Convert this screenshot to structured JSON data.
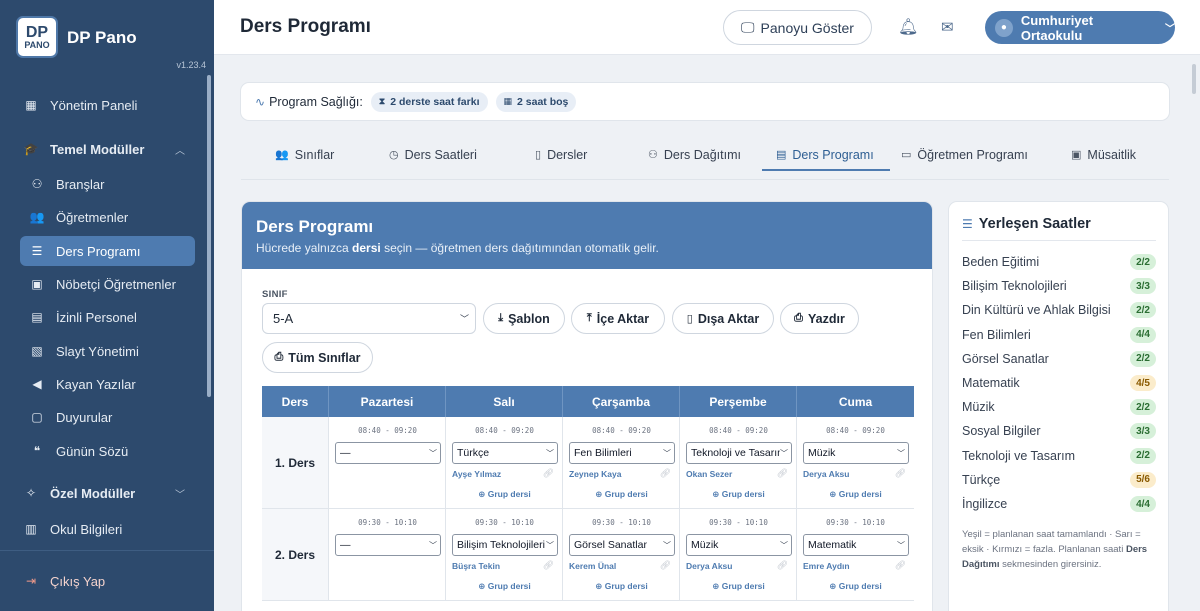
{
  "sidebar": {
    "brand": "DP Pano",
    "logo_top": "DP",
    "logo_bottom": "PANO",
    "version": "v1.23.4",
    "items": [
      {
        "label": "Yönetim Paneli",
        "icon": "dashboard-icon"
      },
      {
        "label": "Temel Modüller",
        "icon": "graduation-cap-icon"
      },
      {
        "label": "Branşlar",
        "icon": "sitemap-icon"
      },
      {
        "label": "Öğretmenler",
        "icon": "users-icon"
      },
      {
        "label": "Ders Programı",
        "icon": "list-icon"
      },
      {
        "label": "Nöbetçi Öğretmenler",
        "icon": "id-badge-icon"
      },
      {
        "label": "İzinli Personel",
        "icon": "calendar-icon"
      },
      {
        "label": "Slayt Yönetimi",
        "icon": "images-icon"
      },
      {
        "label": "Kayan Yazılar",
        "icon": "megaphone-icon"
      },
      {
        "label": "Duyurular",
        "icon": "bell-icon"
      },
      {
        "label": "Günün Sözü",
        "icon": "quote-icon"
      },
      {
        "label": "Özel Modüller",
        "icon": "puzzle-icon"
      },
      {
        "label": "Okul Bilgileri",
        "icon": "building-icon"
      }
    ],
    "logout": "Çıkış Yap"
  },
  "header": {
    "title": "Ders Programı",
    "show_board": "Panoyu Göster",
    "school": "Cumhuriyet Ortaokulu"
  },
  "health": {
    "label": "Program Sağlığı:",
    "pills": [
      "2 derste saat farkı",
      "2 saat boş"
    ]
  },
  "tabs": [
    {
      "label": "Sınıflar",
      "icon": "users-icon"
    },
    {
      "label": "Ders Saatleri",
      "icon": "clock-icon"
    },
    {
      "label": "Dersler",
      "icon": "book-icon"
    },
    {
      "label": "Ders Dağıtımı",
      "icon": "sitemap-icon"
    },
    {
      "label": "Ders Programı",
      "icon": "calendar-icon"
    },
    {
      "label": "Öğretmen Programı",
      "icon": "id-card-icon"
    },
    {
      "label": "Müsaitlik",
      "icon": "calendar-check-icon"
    }
  ],
  "active_tab": "Ders Programı",
  "card": {
    "title": "Ders Programı",
    "sub_pre": "Hücrede yalnızca ",
    "sub_bold": "dersi",
    "sub_post": " seçin — öğretmen ders dağıtımından otomatik gelir.",
    "class_label": "SINIF",
    "class_value": "5-A",
    "buttons": [
      "Şablon",
      "İçe Aktar",
      "Dışa Aktar",
      "Yazdır",
      "Tüm Sınıflar"
    ]
  },
  "table": {
    "headers": [
      "Ders",
      "Pazartesi",
      "Salı",
      "Çarşamba",
      "Perşembe",
      "Cuma"
    ],
    "group_label": "Grup dersi",
    "rows": [
      {
        "label": "1. Ders",
        "time": "08:40 - 09:20",
        "cells": [
          {
            "subject": "—",
            "teacher": ""
          },
          {
            "subject": "Türkçe",
            "teacher": "Ayşe Yılmaz"
          },
          {
            "subject": "Fen Bilimleri",
            "teacher": "Zeynep Kaya"
          },
          {
            "subject": "Teknoloji ve Tasarım",
            "teacher": "Okan Sezer"
          },
          {
            "subject": "Müzik",
            "teacher": "Derya Aksu"
          }
        ]
      },
      {
        "label": "2. Ders",
        "time": "09:30 - 10:10",
        "cells": [
          {
            "subject": "—",
            "teacher": ""
          },
          {
            "subject": "Bilişim Teknolojileri",
            "teacher": "Büşra Tekin"
          },
          {
            "subject": "Görsel Sanatlar",
            "teacher": "Kerem Ünal"
          },
          {
            "subject": "Müzik",
            "teacher": "Derya Aksu"
          },
          {
            "subject": "Matematik",
            "teacher": "Emre Aydın"
          }
        ]
      }
    ]
  },
  "placed": {
    "title": "Yerleşen Saatler",
    "items": [
      {
        "name": "Beden Eğitimi",
        "count": "2/2",
        "status": "ok"
      },
      {
        "name": "Bilişim Teknolojileri",
        "count": "3/3",
        "status": "ok"
      },
      {
        "name": "Din Kültürü ve Ahlak Bilgisi",
        "count": "2/2",
        "status": "ok"
      },
      {
        "name": "Fen Bilimleri",
        "count": "4/4",
        "status": "ok"
      },
      {
        "name": "Görsel Sanatlar",
        "count": "2/2",
        "status": "ok"
      },
      {
        "name": "Matematik",
        "count": "4/5",
        "status": "lack"
      },
      {
        "name": "Müzik",
        "count": "2/2",
        "status": "ok"
      },
      {
        "name": "Sosyal Bilgiler",
        "count": "3/3",
        "status": "ok"
      },
      {
        "name": "Teknoloji ve Tasarım",
        "count": "2/2",
        "status": "ok"
      },
      {
        "name": "Türkçe",
        "count": "5/6",
        "status": "lack"
      },
      {
        "name": "İngilizce",
        "count": "4/4",
        "status": "ok"
      }
    ],
    "note_pre": "Yeşil = planlanan saat tamamlandı · Sarı = eksik · Kırmızı = fazla. Planlanan saati ",
    "note_bold": "Ders Dağıtımı",
    "note_post": " sekmesinden girersiniz."
  },
  "colors": {
    "primary": "#4e7bb0",
    "sidebar": "#2d4a6d"
  }
}
